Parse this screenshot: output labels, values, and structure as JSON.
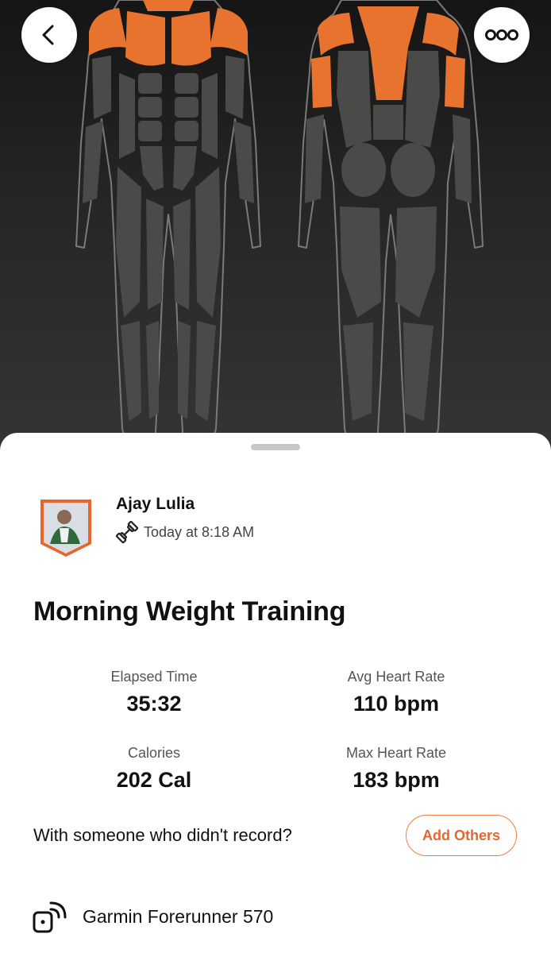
{
  "athlete": {
    "name": "Ajay Lulia",
    "timestamp": "Today at 8:18 AM"
  },
  "activity": {
    "title": "Morning Weight Training"
  },
  "stats": [
    {
      "label": "Elapsed Time",
      "value": "35:32"
    },
    {
      "label": "Avg Heart Rate",
      "value": "110 bpm"
    },
    {
      "label": "Calories",
      "value": "202 Cal"
    },
    {
      "label": "Max Heart Rate",
      "value": "183 bpm"
    }
  ],
  "tag_partners": {
    "prompt": "With someone who didn't record?",
    "button_label": "Add Others"
  },
  "device": {
    "name": "Garmin Forerunner 570"
  },
  "icons": {
    "back": "chevron-left-icon",
    "more": "more-dots-icon",
    "sport": "dumbbell-icon",
    "device": "watch-sync-icon"
  },
  "colors": {
    "accent": "#e8652b",
    "worked_muscle": "#e8732e",
    "idle_muscle": "#4a4a48",
    "hero_background": "#262626"
  },
  "muscle_map": {
    "worked_muscles": [
      "chest",
      "shoulders",
      "upper-back",
      "triceps"
    ]
  }
}
